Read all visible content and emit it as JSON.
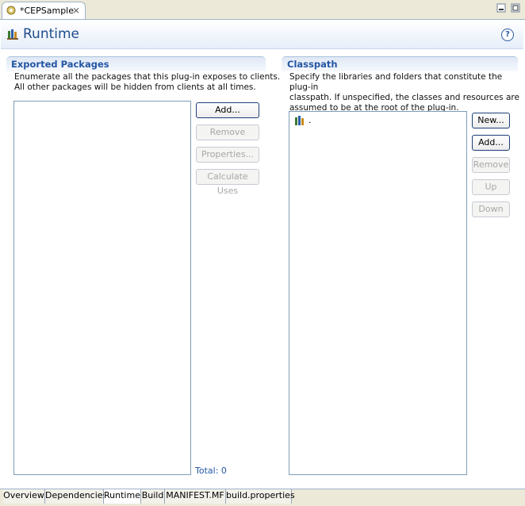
{
  "editor_tab": {
    "title": "*CEPSample"
  },
  "header": {
    "title": "Runtime",
    "help_symbol": "?"
  },
  "exported": {
    "title": "Exported Packages",
    "description_lines": [
      "Enumerate all the packages that this plug-in exposes to clients.",
      "All other packages will be hidden from clients at all times."
    ],
    "buttons": {
      "add": "Add...",
      "remove": "Remove",
      "properties": "Properties...",
      "calculate": "Calculate Uses"
    },
    "total_label": "Total: 0"
  },
  "classpath": {
    "title": "Classpath",
    "description_lines": [
      "Specify the libraries and folders that constitute the plug-in",
      "classpath.  If unspecified, the classes and resources are",
      "assumed to be at the root of the plug-in."
    ],
    "entries": [
      "."
    ],
    "buttons": {
      "new": "New...",
      "add": "Add...",
      "remove": "Remove",
      "up": "Up",
      "down": "Down"
    }
  },
  "page_tabs": [
    "Overview",
    "Dependencies",
    "Runtime",
    "Build",
    "MANIFEST.MF",
    "build.properties"
  ],
  "active_page_tab": "Runtime",
  "colors": {
    "accent": "#2456a4",
    "title": "#1f4c8c",
    "border": "#7f9db9"
  }
}
